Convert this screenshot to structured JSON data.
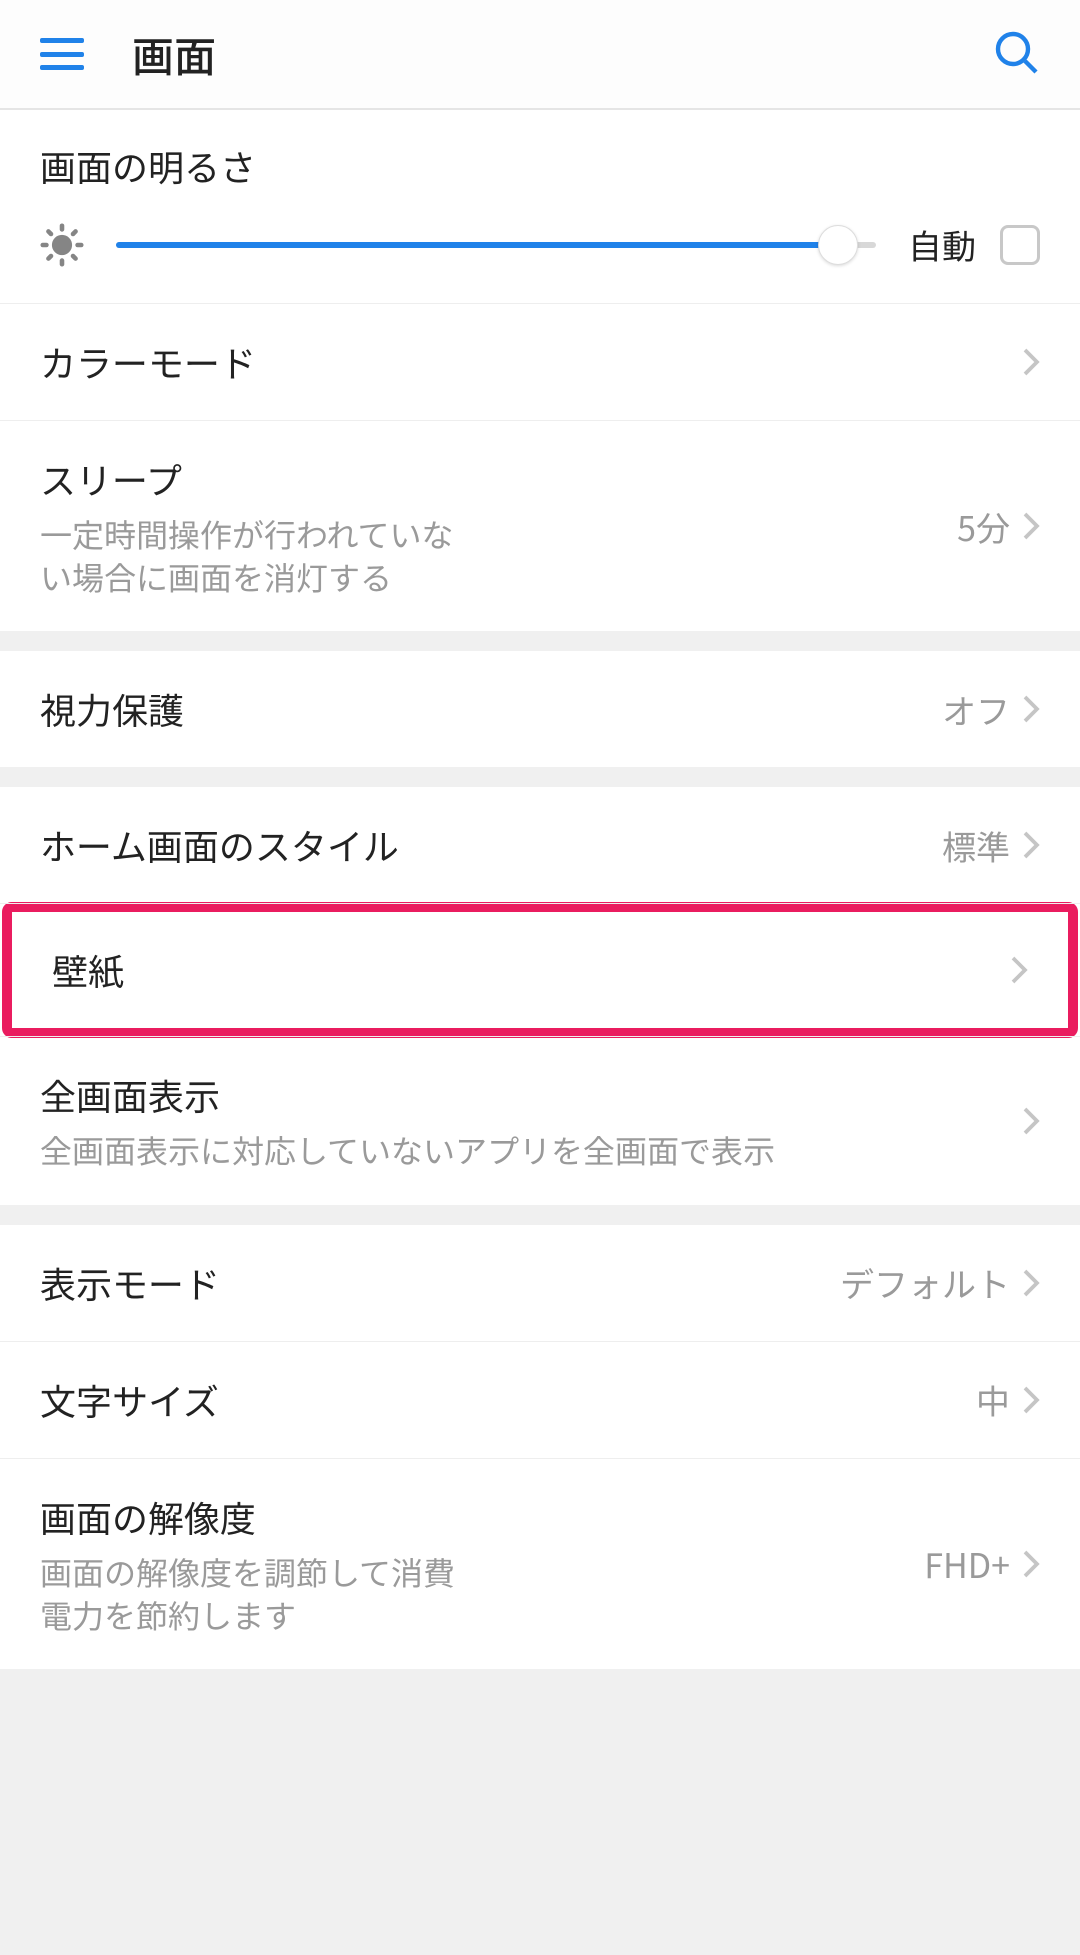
{
  "header": {
    "title": "画面"
  },
  "brightness": {
    "label": "画面の明るさ",
    "auto_label": "自動",
    "value_pct": 95
  },
  "rows": {
    "color_mode": {
      "label": "カラーモード"
    },
    "sleep": {
      "label": "スリープ",
      "sub": "一定時間操作が行われていない場合に画面を消灯する",
      "value": "5分"
    },
    "eye_comfort": {
      "label": "視力保護",
      "value": "オフ"
    },
    "home_style": {
      "label": "ホーム画面のスタイル",
      "value": "標準"
    },
    "wallpaper": {
      "label": "壁紙"
    },
    "fullscreen": {
      "label": "全画面表示",
      "sub": "全画面表示に対応していないアプリを全画面で表示"
    },
    "view_mode": {
      "label": "表示モード",
      "value": "デフォルト"
    },
    "font_size": {
      "label": "文字サイズ",
      "value": "中"
    },
    "resolution": {
      "label": "画面の解像度",
      "sub": "画面の解像度を調節して消費電力を節約します",
      "value": "FHD+"
    }
  }
}
